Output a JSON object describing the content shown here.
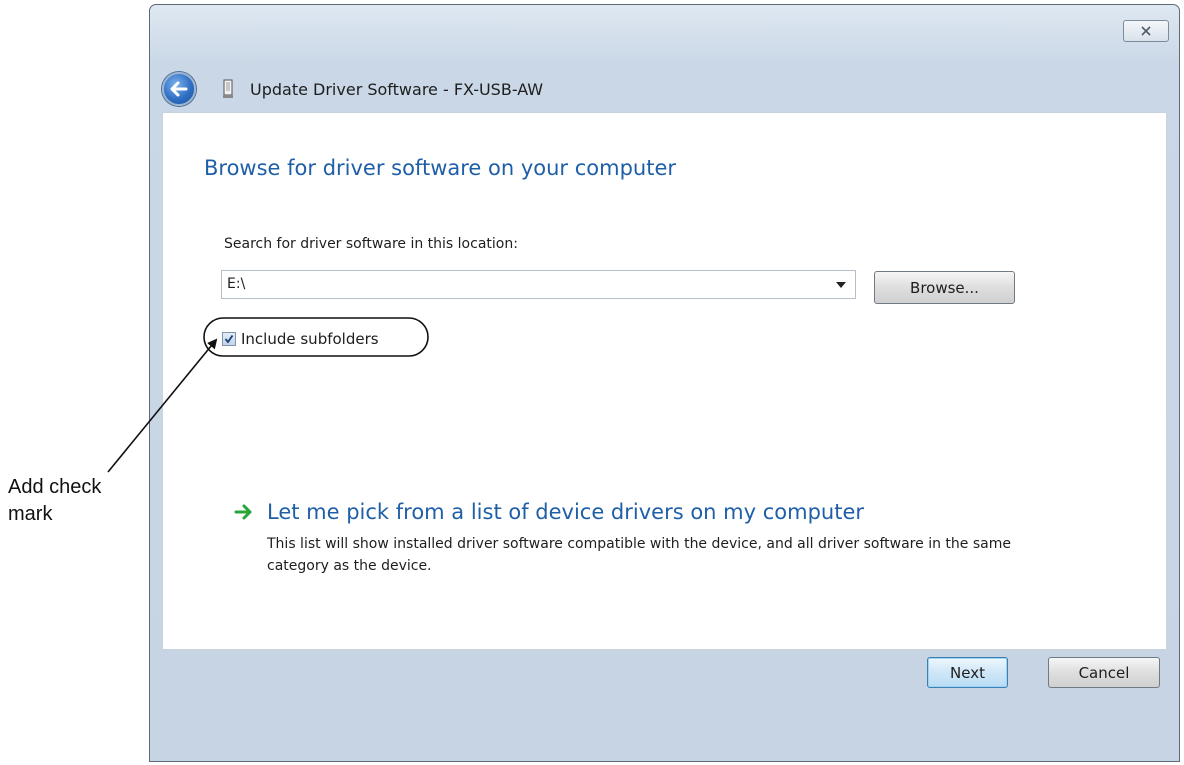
{
  "annotation": {
    "callout_text_line1": "Add check",
    "callout_text_line2": "mark"
  },
  "window": {
    "title": "Update Driver Software - FX-USB-AW",
    "icons": {
      "back": "back-arrow-icon",
      "device": "usb-device-icon",
      "close": "close-icon"
    }
  },
  "content": {
    "page_title": "Browse for driver software on your computer",
    "location_label": "Search for driver software in this location:",
    "path_value": "E:\\",
    "browse_label": "Browse...",
    "include_subfolders": {
      "label": "Include subfolders",
      "checked": true
    },
    "pick_link": "Let me pick from a list of device drivers on my computer",
    "pick_description": "This list will show installed driver software compatible with the device, and all driver software in the same category as the device."
  },
  "footer": {
    "next_label": "Next",
    "cancel_label": "Cancel"
  },
  "colors": {
    "link_blue": "#1f5fa8",
    "arrow_green": "#2aa53b",
    "window_frame": "#c6d4e4"
  }
}
